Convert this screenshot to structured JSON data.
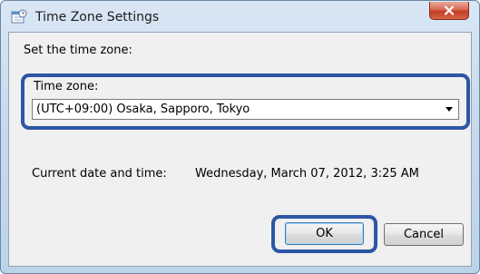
{
  "window": {
    "title": "Time Zone Settings",
    "close_label": "x"
  },
  "main": {
    "prompt": "Set the time zone:",
    "timezone_label": "Time zone:",
    "timezone_value": "(UTC+09:00) Osaka, Sapporo, Tokyo",
    "datetime_label": "Current date and time:",
    "datetime_value": "Wednesday, March 07, 2012, 3:25 AM"
  },
  "buttons": {
    "ok": "OK",
    "cancel": "Cancel"
  },
  "colors": {
    "highlight": "#2d56a6",
    "close_button": "#c23e24"
  }
}
